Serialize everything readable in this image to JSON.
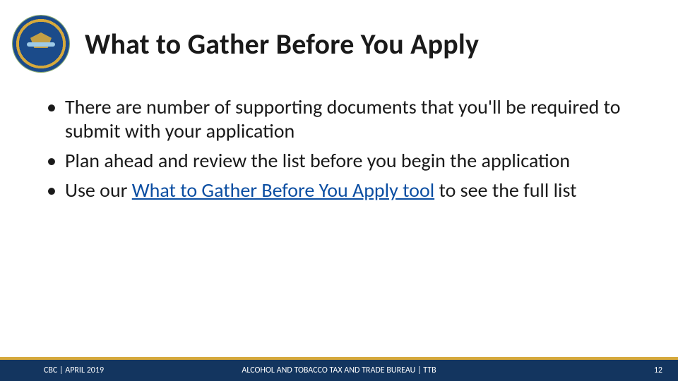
{
  "header": {
    "title": "What to Gather Before You Apply",
    "seal_alt": "TTB agency seal"
  },
  "bullets": [
    {
      "text": "There are number of supporting documents that you'll be required to submit with your application"
    },
    {
      "text_before": "Plan ahead and review the list before you begin the application"
    },
    {
      "text_before": "Use our ",
      "link_text": "What to Gather Before You Apply tool",
      "text_after": " to see the full list"
    }
  ],
  "footer": {
    "left": "CBC | APRIL 2019",
    "center": "ALCOHOL AND TOBACCO TAX AND TRADE BUREAU | TTB",
    "page_number": "12"
  }
}
